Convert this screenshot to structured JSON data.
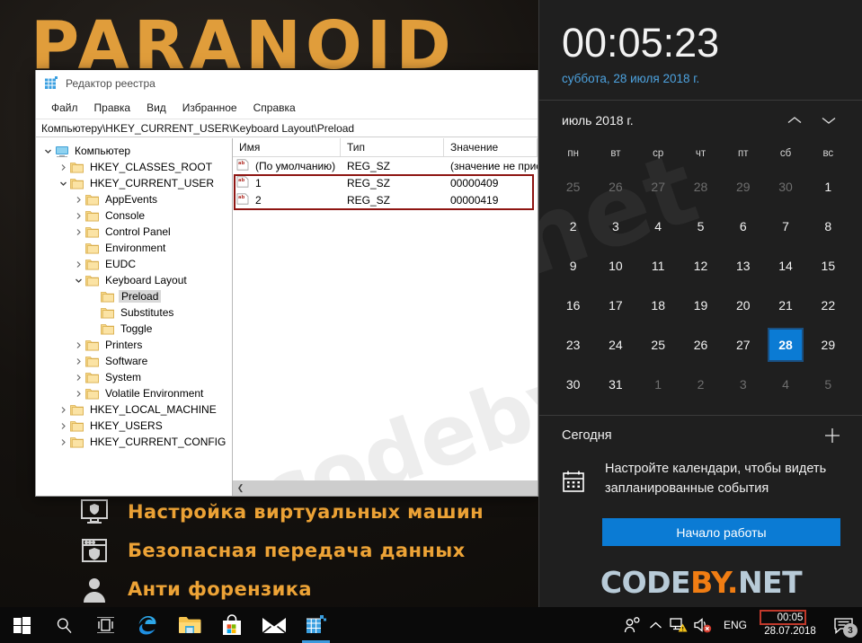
{
  "desktop": {
    "wallpaper_title": "PARANOID",
    "feature_list": [
      {
        "icon": "monitor-shield-icon",
        "label": "Настройка виртуальных машин"
      },
      {
        "icon": "browser-shield-icon",
        "label": "Безопасная передача данных"
      },
      {
        "icon": "person-icon",
        "label": "Анти форензика"
      }
    ],
    "watermark": "codeby.net"
  },
  "regedit": {
    "title": "Редактор реестра",
    "title_icon": "registry-editor-icon",
    "menu": [
      "Файл",
      "Правка",
      "Вид",
      "Избранное",
      "Справка"
    ],
    "address": "Компьютеру\\HKEY_CURRENT_USER\\Keyboard Layout\\Preload",
    "tree": [
      {
        "label": "Компьютер",
        "depth": 0,
        "chevron": "down",
        "icon": "computer-icon",
        "selected": false
      },
      {
        "label": "HKEY_CLASSES_ROOT",
        "depth": 1,
        "chevron": "right",
        "icon": "folder-icon",
        "selected": false
      },
      {
        "label": "HKEY_CURRENT_USER",
        "depth": 1,
        "chevron": "down",
        "icon": "folder-icon",
        "selected": false
      },
      {
        "label": "AppEvents",
        "depth": 2,
        "chevron": "right",
        "icon": "folder-icon",
        "selected": false
      },
      {
        "label": "Console",
        "depth": 2,
        "chevron": "right",
        "icon": "folder-icon",
        "selected": false
      },
      {
        "label": "Control Panel",
        "depth": 2,
        "chevron": "right",
        "icon": "folder-icon",
        "selected": false
      },
      {
        "label": "Environment",
        "depth": 2,
        "chevron": "none",
        "icon": "folder-icon",
        "selected": false
      },
      {
        "label": "EUDC",
        "depth": 2,
        "chevron": "right",
        "icon": "folder-icon",
        "selected": false
      },
      {
        "label": "Keyboard Layout",
        "depth": 2,
        "chevron": "down",
        "icon": "folder-icon",
        "selected": false
      },
      {
        "label": "Preload",
        "depth": 3,
        "chevron": "none",
        "icon": "folder-icon",
        "selected": true
      },
      {
        "label": "Substitutes",
        "depth": 3,
        "chevron": "none",
        "icon": "folder-icon",
        "selected": false
      },
      {
        "label": "Toggle",
        "depth": 3,
        "chevron": "none",
        "icon": "folder-icon",
        "selected": false
      },
      {
        "label": "Printers",
        "depth": 2,
        "chevron": "right",
        "icon": "folder-icon",
        "selected": false
      },
      {
        "label": "Software",
        "depth": 2,
        "chevron": "right",
        "icon": "folder-icon",
        "selected": false
      },
      {
        "label": "System",
        "depth": 2,
        "chevron": "right",
        "icon": "folder-icon",
        "selected": false
      },
      {
        "label": "Volatile Environment",
        "depth": 2,
        "chevron": "right",
        "icon": "folder-icon",
        "selected": false
      },
      {
        "label": "HKEY_LOCAL_MACHINE",
        "depth": 1,
        "chevron": "right",
        "icon": "folder-icon",
        "selected": false
      },
      {
        "label": "HKEY_USERS",
        "depth": 1,
        "chevron": "right",
        "icon": "folder-icon",
        "selected": false
      },
      {
        "label": "HKEY_CURRENT_CONFIG",
        "depth": 1,
        "chevron": "right",
        "icon": "folder-icon",
        "selected": false
      }
    ],
    "list": {
      "columns": [
        "Имя",
        "Тип",
        "Значение"
      ],
      "rows": [
        {
          "icon": "string-value-icon",
          "name": "(По умолчанию)",
          "type": "REG_SZ",
          "value": "(значение не присвоено)"
        },
        {
          "icon": "string-value-icon",
          "name": "1",
          "type": "REG_SZ",
          "value": "00000409"
        },
        {
          "icon": "string-value-icon",
          "name": "2",
          "type": "REG_SZ",
          "value": "00000419"
        }
      ],
      "highlight_color": "#8e1512"
    },
    "scroll_left_icon": "chevron-left-icon"
  },
  "flyout": {
    "time": "00:05:23",
    "date": "суббота, 28 июля 2018 г.",
    "calendar": {
      "month_label": "июль 2018 г.",
      "prev_icon": "chevron-up-icon",
      "next_icon": "chevron-down-icon",
      "day_names": [
        "пн",
        "вт",
        "ср",
        "чт",
        "пт",
        "сб",
        "вс"
      ],
      "weeks": [
        [
          {
            "d": "25",
            "m": true
          },
          {
            "d": "26",
            "m": true
          },
          {
            "d": "27",
            "m": true
          },
          {
            "d": "28",
            "m": true
          },
          {
            "d": "29",
            "m": true
          },
          {
            "d": "30",
            "m": true
          },
          {
            "d": "1",
            "m": false
          }
        ],
        [
          {
            "d": "2",
            "m": false
          },
          {
            "d": "3",
            "m": false
          },
          {
            "d": "4",
            "m": false
          },
          {
            "d": "5",
            "m": false
          },
          {
            "d": "6",
            "m": false
          },
          {
            "d": "7",
            "m": false
          },
          {
            "d": "8",
            "m": false
          }
        ],
        [
          {
            "d": "9",
            "m": false
          },
          {
            "d": "10",
            "m": false
          },
          {
            "d": "11",
            "m": false
          },
          {
            "d": "12",
            "m": false
          },
          {
            "d": "13",
            "m": false
          },
          {
            "d": "14",
            "m": false
          },
          {
            "d": "15",
            "m": false
          }
        ],
        [
          {
            "d": "16",
            "m": false
          },
          {
            "d": "17",
            "m": false
          },
          {
            "d": "18",
            "m": false
          },
          {
            "d": "19",
            "m": false
          },
          {
            "d": "20",
            "m": false
          },
          {
            "d": "21",
            "m": false
          },
          {
            "d": "22",
            "m": false
          }
        ],
        [
          {
            "d": "23",
            "m": false
          },
          {
            "d": "24",
            "m": false
          },
          {
            "d": "25",
            "m": false
          },
          {
            "d": "26",
            "m": false
          },
          {
            "d": "27",
            "m": false
          },
          {
            "d": "28",
            "m": false,
            "today": true
          },
          {
            "d": "29",
            "m": false
          }
        ],
        [
          {
            "d": "30",
            "m": false
          },
          {
            "d": "31",
            "m": false
          },
          {
            "d": "1",
            "m": true
          },
          {
            "d": "2",
            "m": true
          },
          {
            "d": "3",
            "m": true
          },
          {
            "d": "4",
            "m": true
          },
          {
            "d": "5",
            "m": true
          }
        ]
      ],
      "today_accent": "#0b7bd4"
    },
    "agenda": {
      "title": "Сегодня",
      "add_icon": "plus-icon",
      "calendar_icon": "calendar-icon",
      "message": "Настройте календари, чтобы видеть запланированные события",
      "button_label": "Начало работы"
    },
    "brand": {
      "part1": "CODE",
      "part2": "BY",
      "part3": ".",
      "part4": "NET"
    }
  },
  "taskbar": {
    "start_icon": "windows-start-icon",
    "search_icon": "search-icon",
    "taskview_icon": "task-view-icon",
    "apps": [
      {
        "icon": "edge-icon",
        "active": false
      },
      {
        "icon": "file-explorer-icon",
        "active": false
      },
      {
        "icon": "microsoft-store-icon",
        "active": false
      },
      {
        "icon": "mail-icon",
        "active": false
      },
      {
        "icon": "registry-editor-icon",
        "active": true
      }
    ],
    "tray": [
      {
        "icon": "people-icon"
      },
      {
        "icon": "show-hidden-icons-chevron"
      },
      {
        "icon": "network-warning-icon"
      },
      {
        "icon": "volume-muted-icon"
      }
    ],
    "language": "ENG",
    "clock_time": "00:05",
    "clock_date": "28.07.2018",
    "clock_highlight": "#c0392b",
    "action_center_icon": "action-center-icon",
    "notification_count": "3"
  }
}
